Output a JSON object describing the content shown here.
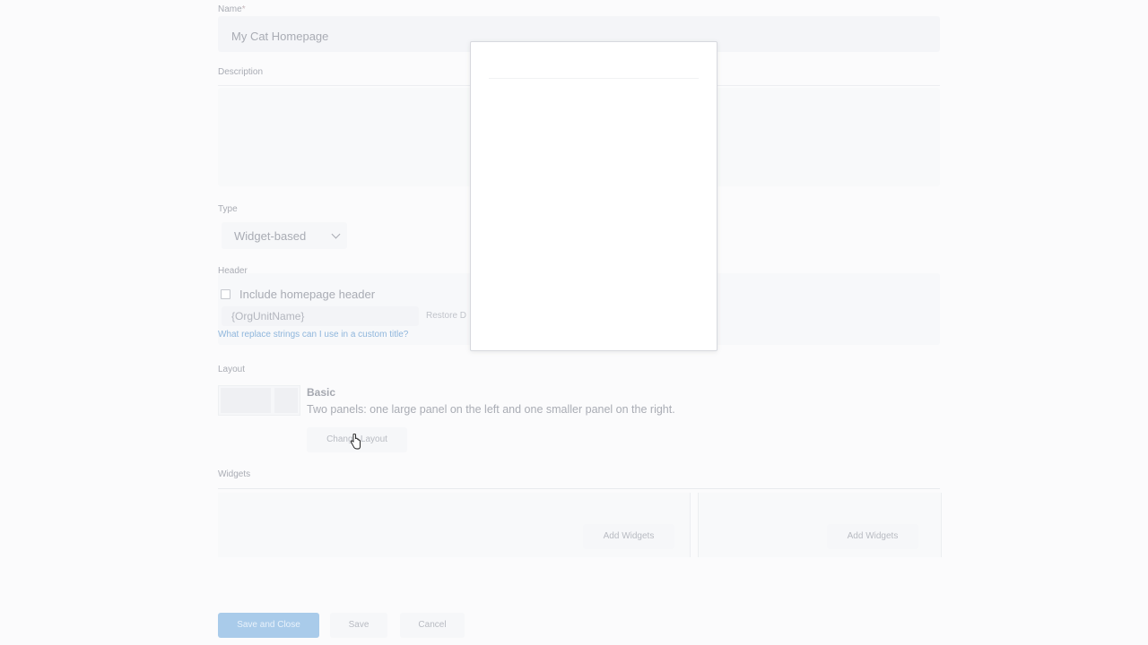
{
  "form": {
    "name_label": "Name",
    "name_required_mark": "*",
    "name_value": "My Cat Homepage",
    "description_label": "Description",
    "type_label": "Type",
    "type_value": "Widget-based",
    "header_label": "Header",
    "include_header_label": "Include homepage header",
    "header_input_value": "{OrgUnitName}",
    "restore_default_label": "Restore D",
    "replace_strings_link": "What replace strings can I use in a custom title?",
    "layout_label": "Layout",
    "layout_name": "Basic",
    "layout_description": "Two panels: one large panel on the left and one smaller panel on the right.",
    "change_layout_button": "Change Layout",
    "widgets_label": "Widgets",
    "add_widgets_left": "Add Widgets",
    "add_widgets_right": "Add Widgets"
  },
  "footer": {
    "save_and_close": "Save and Close",
    "save": "Save",
    "cancel": "Cancel"
  },
  "colors": {
    "primary": "#a9cbea",
    "background": "#fbfbfc",
    "modal": "#ffffff"
  }
}
